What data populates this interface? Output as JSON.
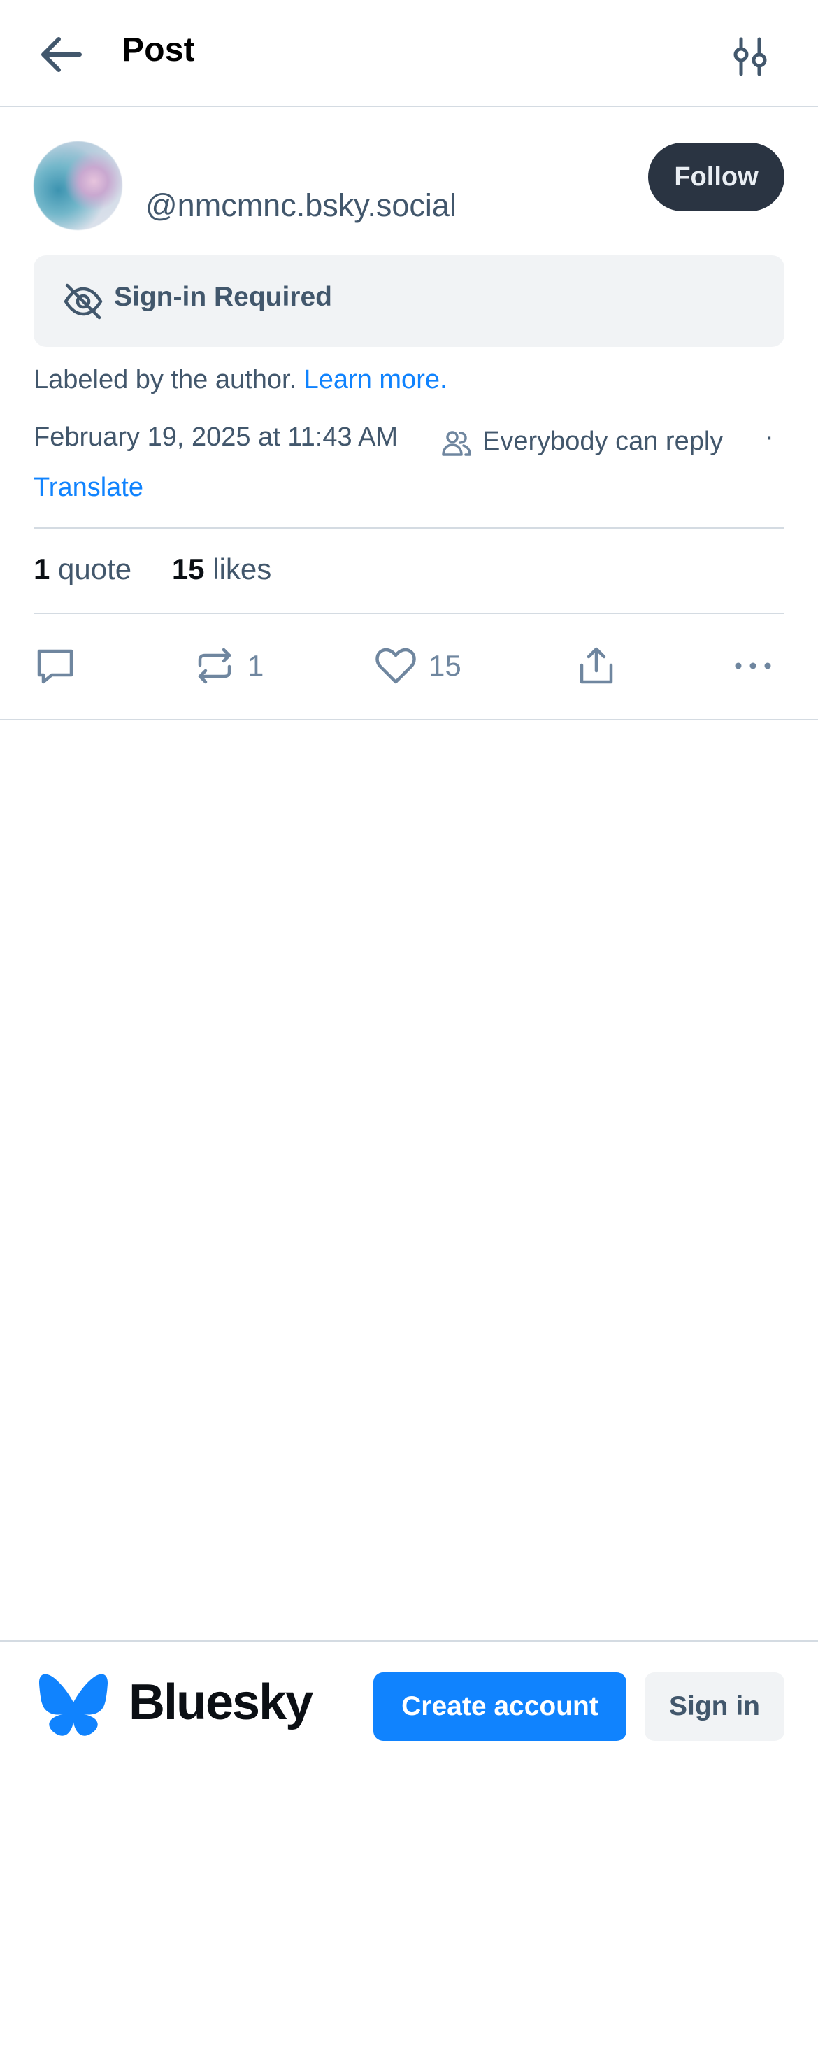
{
  "header": {
    "back_icon": "arrow-left-icon",
    "title": "Post",
    "settings_icon": "sliders-icon"
  },
  "post": {
    "handle": "@nmcmnc.bsky.social",
    "follow_label": "Follow",
    "content_warning": {
      "icon": "eye-slash-icon",
      "text": "Sign-in Required"
    },
    "label_text": "Labeled by the author.",
    "learn_more": "Learn more.",
    "timestamp": "February 19, 2025 at 11:43 AM",
    "reply_setting_icon": "people-icon",
    "reply_setting": "Everybody can reply",
    "separator": "·",
    "translate": "Translate",
    "stats": {
      "quotes_count": "1",
      "quotes_label": "quote",
      "likes_count": "15",
      "likes_label": "likes"
    },
    "actions": {
      "reply_icon": "comment-icon",
      "repost_icon": "repost-icon",
      "repost_count": "1",
      "like_icon": "heart-icon",
      "like_count": "15",
      "share_icon": "share-icon",
      "more_icon": "ellipsis-icon"
    }
  },
  "footer": {
    "logo_icon": "butterfly-icon",
    "brand": "Bluesky",
    "create_account": "Create account",
    "sign_in": "Sign in"
  },
  "colors": {
    "accent": "#1083fe",
    "text_muted": "#42576c",
    "icon": "#6f869f",
    "follow_bg": "#2a3442",
    "divider": "#d4dbe2",
    "box_bg": "#f1f3f5"
  }
}
